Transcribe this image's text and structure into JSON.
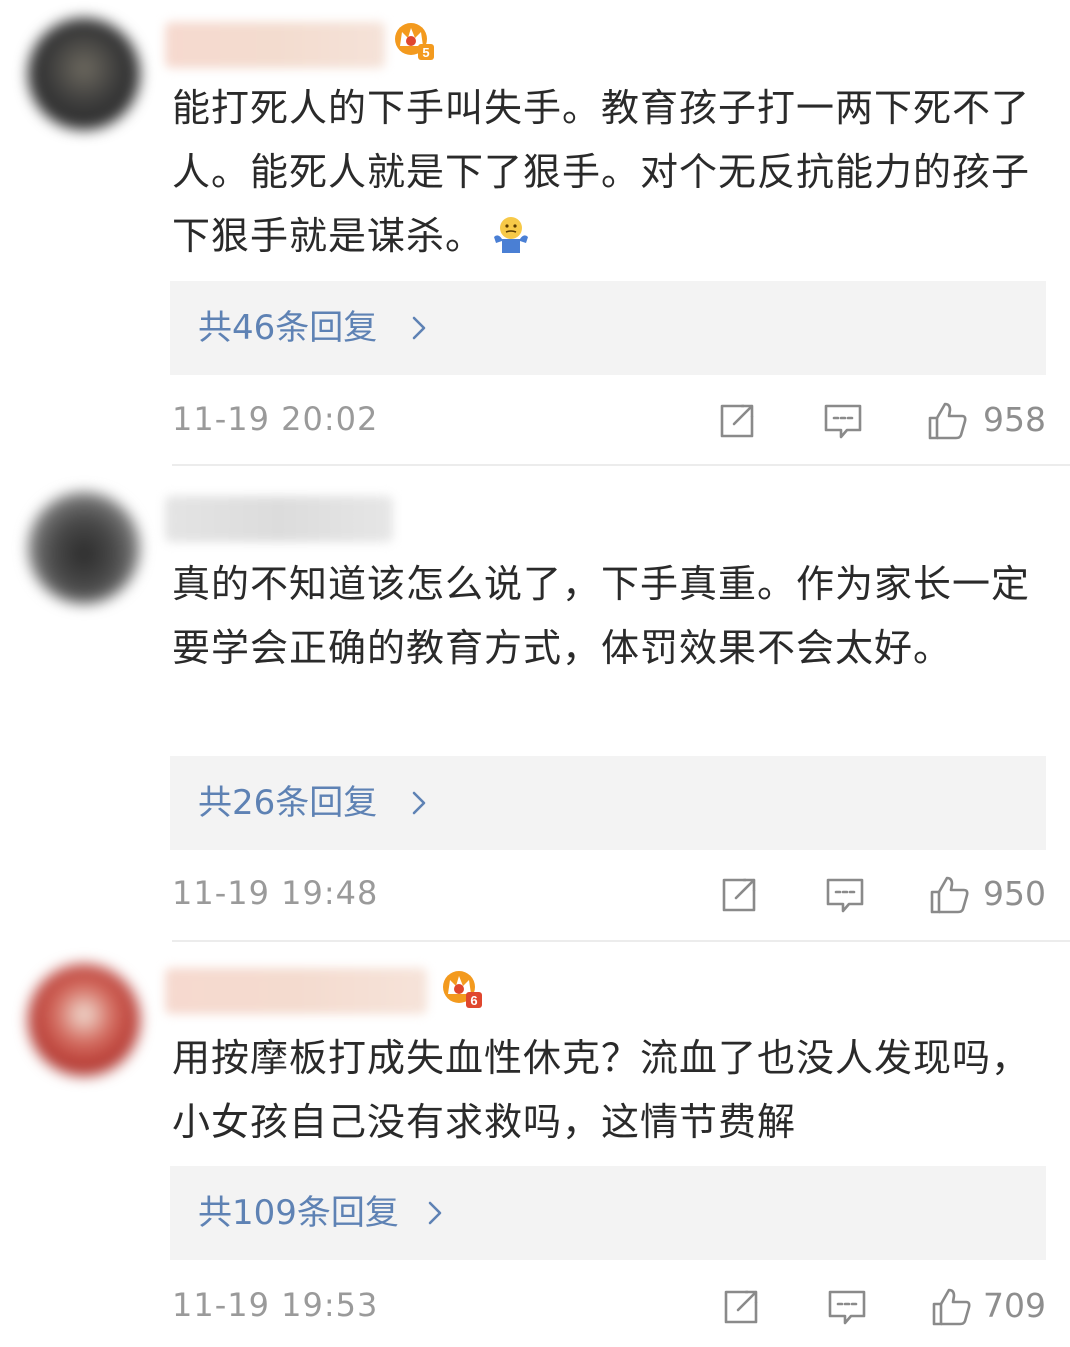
{
  "comments": [
    {
      "text": "能打死人的下手叫失手。教育孩子打一两下死不了人。能死人就是下了狠手。对个无反抗能力的孩子下狠手就是谋杀。",
      "emoji_icon": "shrug-emoji-icon",
      "badge_icon": "crown-level-icon",
      "badge_level": "5",
      "replies_label": "共46条回复",
      "timestamp": "11-19 20:02",
      "likes": "958"
    },
    {
      "text": "真的不知道该怎么说了，下手真重。作为家长一定要学会正确的教育方式，体罚效果不会太好。",
      "replies_label": "共26条回复",
      "timestamp": "11-19 19:48",
      "likes": "950"
    },
    {
      "text": "用按摩板打成失血性休克？流血了也没人发现吗，小女孩自己没有求救吗，这情节费解",
      "badge_icon": "crown-level-icon",
      "badge_level": "6",
      "replies_label": "共109条回复",
      "timestamp": "11-19 19:53",
      "likes": "709"
    }
  ],
  "icons": {
    "share": "share-icon",
    "comment": "comment-icon",
    "like": "thumbs-up-icon",
    "chevron": "chevron-right-icon"
  },
  "colors": {
    "reply_link": "#5e82b4",
    "reply_bg": "#f3f3f3",
    "meta_gray": "#9a9a9a",
    "crown_orange": "#f39a1e",
    "crown_red": "#e0472e"
  }
}
